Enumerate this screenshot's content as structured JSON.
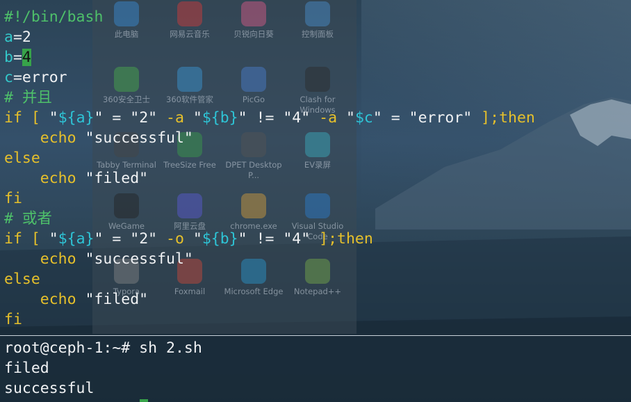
{
  "desktop": {
    "icons": [
      {
        "label": "此电脑",
        "icon": "computer-icon",
        "color": "#3a8fd9"
      },
      {
        "label": "网易云音乐",
        "icon": "netease-music-icon",
        "color": "#d83a3a"
      },
      {
        "label": "贝锐向日葵",
        "icon": "sunlogin-icon",
        "color": "#e05a8a"
      },
      {
        "label": "控制面板",
        "icon": "control-panel-icon",
        "color": "#4a90d0"
      },
      {
        "label": "360安全卫士",
        "icon": "360-safe-icon",
        "color": "#49b04a"
      },
      {
        "label": "360软件管家",
        "icon": "360-software-icon",
        "color": "#3a9ad9"
      },
      {
        "label": "PicGo",
        "icon": "picgo-icon",
        "color": "#4a7fd0"
      },
      {
        "label": "Clash for Windows",
        "icon": "clash-icon",
        "color": "#2a2a2a"
      },
      {
        "label": "Tabby Terminal",
        "icon": "tabby-icon",
        "color": "#444444"
      },
      {
        "label": "TreeSize Free",
        "icon": "treesize-icon",
        "color": "#3aa04a"
      },
      {
        "label": "DPET Desktop P...",
        "icon": "dpet-icon",
        "color": "#555555"
      },
      {
        "label": "EV录屏",
        "icon": "ev-recorder-icon",
        "color": "#3ab0c0"
      },
      {
        "label": "WeGame",
        "icon": "wegame-icon",
        "color": "#222222"
      },
      {
        "label": "阿里云盘",
        "icon": "aliyun-drive-icon",
        "color": "#5a5ad9"
      },
      {
        "label": "chrome.exe",
        "icon": "chrome-icon",
        "color": "#d9a03a"
      },
      {
        "label": "Visual Studio Code",
        "icon": "vscode-icon",
        "color": "#2a7fd0"
      },
      {
        "label": "Typora",
        "icon": "typora-icon",
        "color": "#888888"
      },
      {
        "label": "Foxmail",
        "icon": "foxmail-icon",
        "color": "#d04a3a"
      },
      {
        "label": "Microsoft Edge",
        "icon": "edge-icon",
        "color": "#2a9ad0"
      },
      {
        "label": "Notepad++",
        "icon": "notepadpp-icon",
        "color": "#7ab04a"
      }
    ]
  },
  "editor": {
    "shebang": "#!/bin/bash",
    "line_a": {
      "name": "a",
      "rest": "=2"
    },
    "line_b": {
      "name": "b",
      "eq": "=",
      "cursor_char": "4"
    },
    "line_c": {
      "name": "c",
      "rest": "=error"
    },
    "comment_and": "# 并且",
    "if_and": {
      "kw_if": "if",
      "bracket_open": " [ ",
      "q1": "\"",
      "exp_a": "${a}",
      "q2": "\"",
      "eq1": " = ",
      "val_2": "\"2\"",
      "opt_a1": " -a ",
      "q3": "\"",
      "exp_b": "${b}",
      "q4": "\"",
      "ne": " != ",
      "val_4": "\"4\"",
      "opt_a2": " -a ",
      "q5": "\"",
      "exp_c": "$c",
      "q6": "\"",
      "eq2": " = ",
      "val_error": "\"error\"",
      "bracket_close": " ]",
      "semi_then": ";then"
    },
    "echo1": {
      "kw": "echo",
      "str": "\"successful\""
    },
    "else1": "else",
    "echo2": {
      "kw": "echo",
      "str": "\"filed\""
    },
    "fi1": "fi",
    "comment_or": "# 或者",
    "if_or": {
      "kw_if": "if",
      "bracket_open": " [ ",
      "q1": "\"",
      "exp_a": "${a}",
      "q2": "\"",
      "eq1": " = ",
      "val_2": "\"2\"",
      "opt_o": " -o ",
      "q3": "\"",
      "exp_b": "${b}",
      "q4": "\"",
      "ne": " != ",
      "val_4": "\"4\"",
      "bracket_close": " ]",
      "semi_then": ";then"
    },
    "echo3": {
      "kw": "echo",
      "str": "\"successful\""
    },
    "else2": "else",
    "echo4": {
      "kw": "echo",
      "str": "\"filed\""
    },
    "fi2": "fi"
  },
  "terminal": {
    "prompt_line": "root@ceph-1:~# sh 2.sh",
    "output": [
      "filed",
      "successful"
    ]
  },
  "colors": {
    "comment": "#4ec06a",
    "variable": "#33c7c9",
    "keyword": "#e6c02b",
    "expansion": "#2ec4d6",
    "cursor": "#37a34a"
  }
}
